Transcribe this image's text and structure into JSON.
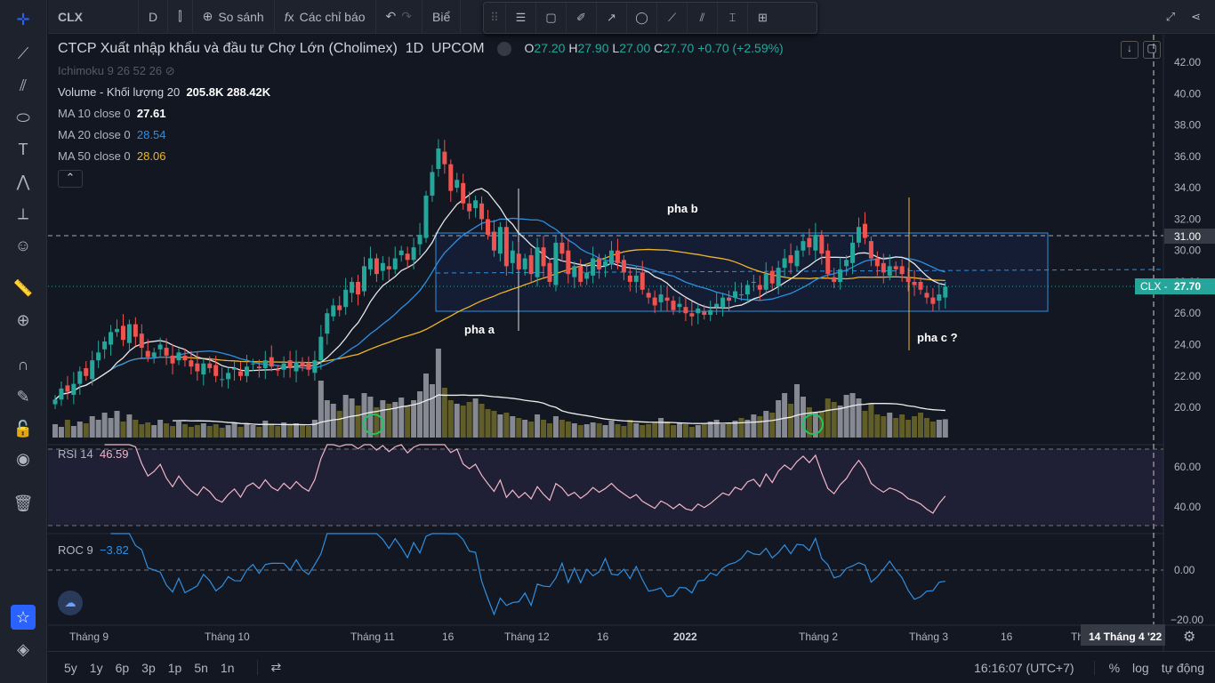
{
  "toolbar": {
    "symbol": "CLX",
    "interval": "D",
    "compare": "So sánh",
    "indicators": "Các chỉ báo",
    "cut": "Biể"
  },
  "legend": {
    "title": "CTCP Xuất nhập khẩu và đầu tư Chợ Lớn (Cholimex)",
    "interval": "1D",
    "exchange": "UPCOM",
    "o_label": "O",
    "o": "27.20",
    "h_label": "H",
    "h": "27.90",
    "l_label": "L",
    "l": "27.00",
    "c_label": "C",
    "c": "27.70",
    "change": "+0.70 (+2.59%)",
    "ichimoku": "Ichimoku 9 26 52 26",
    "volume_label": "Volume - Khối lượng 20",
    "volume_v1": "205.8K",
    "volume_v2": "288.42K",
    "ma10_label": "MA 10 close 0",
    "ma10": "27.61",
    "ma20_label": "MA 20 close 0",
    "ma20": "28.54",
    "ma50_label": "MA 50 close 0",
    "ma50": "28.06",
    "rsi_label": "RSI 14",
    "rsi": "46.59",
    "roc_label": "ROC 9",
    "roc": "−3.82"
  },
  "annotations": {
    "a": "pha a",
    "b": "pha b",
    "c": "pha c ?"
  },
  "price_axis": [
    "42.00",
    "40.00",
    "38.00",
    "36.00",
    "34.00",
    "32.00",
    "30.00",
    "28.00",
    "26.00",
    "24.00",
    "22.00",
    "20.00"
  ],
  "price_label_31": "31.00",
  "current_label": "CLX",
  "current_price": "27.70",
  "rsi_axis": [
    "60.00",
    "40.00"
  ],
  "roc_axis": [
    "0.00",
    "−20.00"
  ],
  "time_axis": [
    "Tháng 9",
    "Tháng 10",
    "Tháng 11",
    "16",
    "Tháng 12",
    "16",
    "2022",
    "Tháng 2",
    "Tháng 3",
    "16",
    "Th"
  ],
  "crosshair_date": "14 Tháng 4 '22",
  "bottom": {
    "ranges": [
      "5y",
      "1y",
      "6p",
      "3p",
      "1p",
      "5n",
      "1n"
    ],
    "time": "16:16:07 (UTC+7)",
    "pct": "%",
    "log": "log",
    "auto": "tự động"
  },
  "colors": {
    "up": "#26a69a",
    "down": "#ef5350",
    "ma10": "#e6e6e6",
    "ma20": "#2f8fe0",
    "ma50": "#f0b429"
  },
  "chart_data": {
    "type": "candlestick",
    "closes": [
      20.5,
      21.2,
      21.0,
      21.5,
      22.3,
      22.0,
      23.0,
      23.5,
      24.2,
      24.8,
      25.0,
      24.3,
      25.3,
      24.5,
      23.8,
      23.2,
      23.5,
      24.0,
      23.3,
      22.8,
      23.5,
      23.0,
      22.6,
      22.3,
      22.8,
      22.5,
      22.0,
      21.8,
      22.2,
      22.5,
      22.0,
      22.6,
      22.8,
      22.5,
      23.0,
      22.6,
      22.4,
      22.8,
      22.5,
      22.9,
      22.6,
      22.4,
      23.0,
      24.5,
      26.0,
      26.5,
      26.2,
      27.5,
      28.0,
      27.2,
      29.0,
      29.5,
      28.5,
      29.2,
      28.8,
      29.5,
      30.0,
      29.4,
      30.2,
      31.0,
      33.5,
      35.0,
      36.5,
      35.5,
      33.8,
      34.5,
      33.0,
      32.5,
      33.2,
      32.0,
      31.0,
      30.0,
      31.5,
      29.0,
      30.0,
      28.8,
      29.5,
      28.5,
      30.2,
      29.0,
      28.0,
      30.5,
      29.8,
      28.5,
      29.0,
      28.0,
      28.6,
      29.5,
      28.8,
      29.3,
      30.0,
      29.2,
      28.6,
      28.0,
      28.4,
      27.5,
      27.0,
      26.5,
      27.2,
      26.8,
      26.2,
      26.6,
      26.0,
      25.8,
      26.3,
      25.9,
      26.2,
      26.6,
      27.0,
      26.8,
      27.4,
      27.2,
      27.8,
      28.0,
      27.5,
      28.5,
      27.9,
      28.9,
      29.5,
      29.2,
      30.0,
      30.6,
      30.2,
      31.0,
      29.8,
      28.5,
      28.0,
      28.8,
      29.4,
      30.5,
      31.5,
      30.8,
      29.5,
      29.0,
      28.6,
      29.0,
      28.8,
      28.5,
      28.0,
      27.8,
      27.5,
      27.0,
      26.6,
      27.2,
      27.7
    ],
    "volumes_k": [
      150,
      120,
      200,
      130,
      180,
      160,
      240,
      200,
      280,
      220,
      300,
      180,
      260,
      200,
      150,
      170,
      140,
      200,
      160,
      130,
      180,
      150,
      120,
      140,
      160,
      130,
      150,
      110,
      140,
      170,
      120,
      160,
      140,
      120,
      190,
      150,
      130,
      170,
      150,
      160,
      140,
      130,
      200,
      640,
      420,
      380,
      300,
      480,
      440,
      360,
      500,
      460,
      340,
      420,
      380,
      400,
      450,
      360,
      420,
      520,
      720,
      600,
      1000,
      560,
      420,
      380,
      360,
      400,
      440,
      380,
      320,
      300,
      260,
      280,
      240,
      220,
      200,
      180,
      260,
      200,
      160,
      240,
      200,
      180,
      160,
      140,
      150,
      170,
      160,
      140,
      190,
      150,
      130,
      200,
      160,
      140,
      150,
      170,
      220,
      180,
      140,
      160,
      150,
      120,
      140,
      160,
      180,
      200,
      150,
      170,
      190,
      220,
      200,
      260,
      240,
      300,
      280,
      420,
      500,
      380,
      600,
      460,
      340,
      280,
      300,
      440,
      400,
      360,
      480,
      500,
      440,
      300,
      380,
      260,
      240,
      280,
      220,
      260,
      200,
      240,
      280,
      220,
      180,
      200,
      206
    ],
    "ylim": [
      19,
      42.5
    ]
  }
}
